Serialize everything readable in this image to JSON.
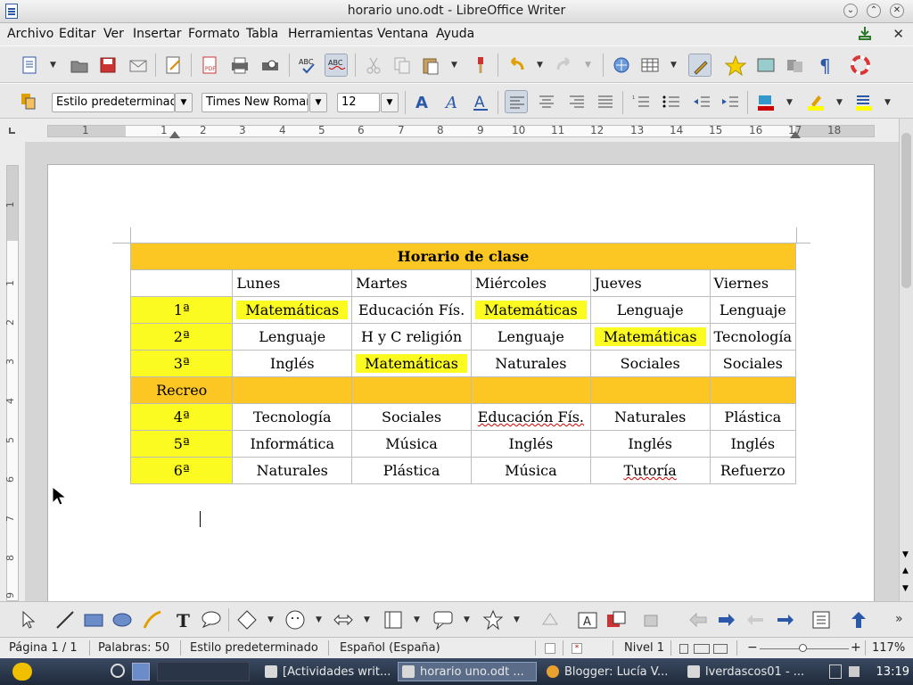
{
  "window": {
    "title": "horario uno.odt - LibreOffice Writer"
  },
  "menu": [
    "Archivo",
    "Editar",
    "Ver",
    "Insertar",
    "Formato",
    "Tabla",
    "Herramientas",
    "Ventana",
    "Ayuda"
  ],
  "formatting": {
    "paragraph_style": "Estilo predeterminado",
    "font_name": "Times New Roman",
    "font_size": "12"
  },
  "ruler": {
    "horizontal": [
      "1",
      "1",
      "2",
      "3",
      "4",
      "5",
      "6",
      "7",
      "8",
      "9",
      "10",
      "11",
      "12",
      "13",
      "14",
      "15",
      "16",
      "17",
      "18"
    ],
    "vertical": [
      "1",
      "1",
      "2",
      "3",
      "4",
      "5",
      "6",
      "7",
      "8",
      "9"
    ]
  },
  "table": {
    "title": "Horario de clase",
    "days": [
      "Lunes",
      "Martes",
      "Miércoles",
      "Jueves",
      "Viernes"
    ],
    "rows": [
      {
        "label": "1ª",
        "cells": [
          "Matemáticas",
          "Educación Fís.",
          "Matemáticas",
          "Lenguaje",
          "Lenguaje"
        ]
      },
      {
        "label": "2ª",
        "cells": [
          "Lenguaje",
          "H y C religión",
          "Lenguaje",
          "Matemáticas",
          "Tecnología"
        ]
      },
      {
        "label": "3ª",
        "cells": [
          "Inglés",
          "Matemáticas",
          "Naturales",
          "Sociales",
          "Sociales"
        ]
      },
      {
        "label": "Recreo",
        "cells": [
          "",
          "",
          "",
          "",
          ""
        ]
      },
      {
        "label": "4ª",
        "cells": [
          "Tecnología",
          "Sociales",
          "Educación Fís.",
          "Naturales",
          "Plástica"
        ]
      },
      {
        "label": "5ª",
        "cells": [
          "Informática",
          "Música",
          "Inglés",
          "Inglés",
          "Inglés"
        ]
      },
      {
        "label": "6ª",
        "cells": [
          "Naturales",
          "Plástica",
          "Música",
          "Tutoría",
          "Refuerzo"
        ]
      }
    ]
  },
  "status": {
    "page": "Página 1 / 1",
    "words": "Palabras: 50",
    "style": "Estilo predeterminado",
    "language": "Español (España)",
    "level": "Nivel 1",
    "zoom": "117%"
  },
  "taskbar": {
    "tasks": [
      "[Actividades writ...",
      "horario uno.odt ...",
      "Blogger: Lucía V...",
      "lverdascos01 - ..."
    ],
    "clock": "13:19"
  },
  "colors": {
    "title_fill": "#fdc723",
    "label_fill": "#fbfb21",
    "highlight": "#fbfb21"
  }
}
